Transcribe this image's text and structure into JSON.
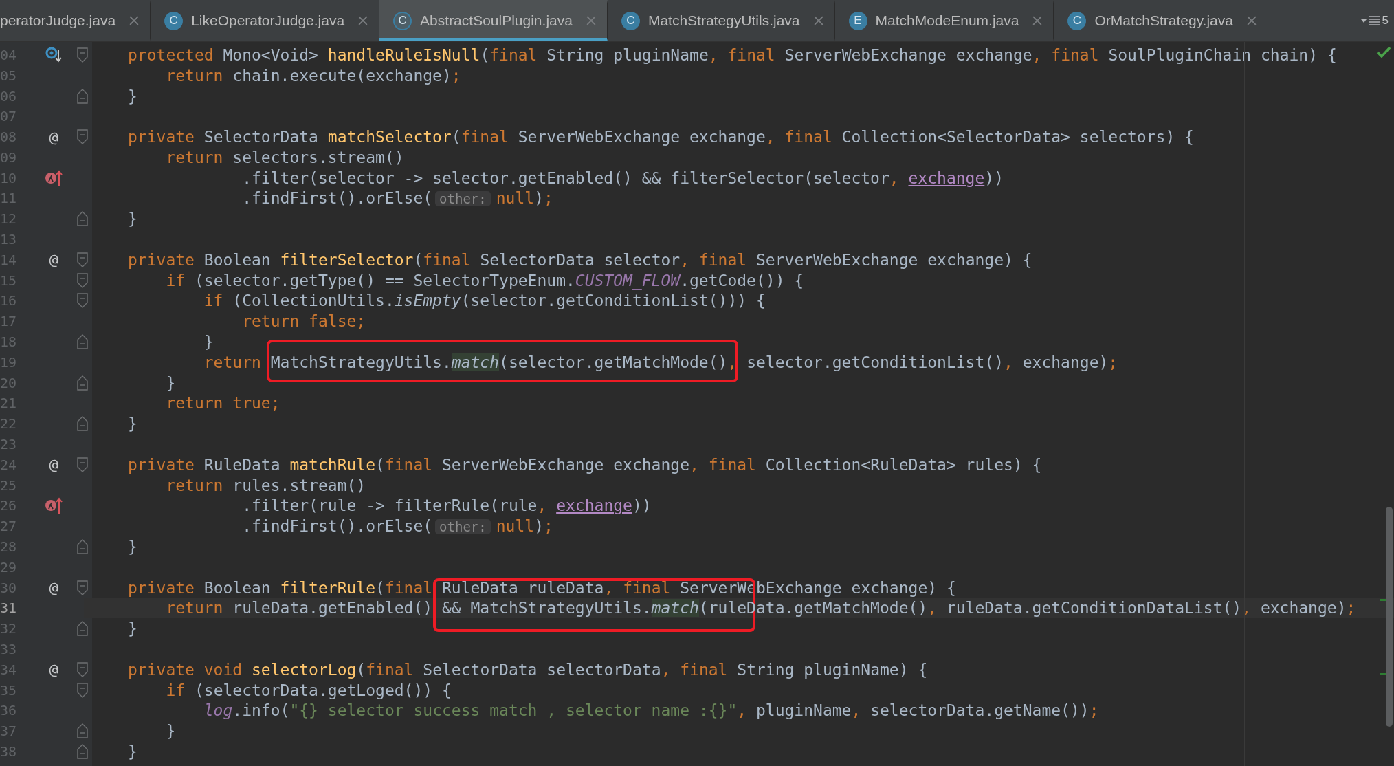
{
  "tabs": [
    {
      "label": "peratorJudge.java",
      "selected": false
    },
    {
      "label": "LikeOperatorJudge.java",
      "icon_letter": "C",
      "abstract": false,
      "selected": false
    },
    {
      "label": "AbstractSoulPlugin.java",
      "icon_letter": "C",
      "abstract": true,
      "selected": true
    },
    {
      "label": "MatchStrategyUtils.java",
      "icon_letter": "C",
      "abstract": false,
      "selected": false
    },
    {
      "label": "MatchModeEnum.java",
      "icon_letter": "E",
      "abstract": false,
      "selected": false
    },
    {
      "label": "OrMatchStrategy.java",
      "icon_letter": "C",
      "abstract": false,
      "selected": false
    }
  ],
  "tab_overflow": {
    "count": "5"
  },
  "lines": [
    {
      "number": "04",
      "current": false,
      "gutter": {
        "kind": "override"
      },
      "fold": {
        "kind": "start"
      },
      "tokens": [
        {
          "kind": "keyword",
          "t": "protected "
        },
        {
          "kind": "text",
          "t": "Mono<Void> "
        },
        {
          "kind": "declaration",
          "t": "handleRuleIsNull"
        },
        {
          "kind": "text",
          "t": "("
        },
        {
          "kind": "keyword",
          "t": "final "
        },
        {
          "kind": "text",
          "t": "String pluginName, "
        },
        {
          "kind": "keyword",
          "t": "final "
        },
        {
          "kind": "text",
          "t": "ServerWebExchange exchange, "
        },
        {
          "kind": "keyword",
          "t": "final "
        },
        {
          "kind": "text",
          "t": "SoulPluginChain chain) {"
        }
      ]
    },
    {
      "number": "05",
      "current": false,
      "tokens": [
        {
          "kind": "keyword",
          "t": "    return "
        },
        {
          "kind": "text",
          "t": "chain.execute(exchange);"
        }
      ]
    },
    {
      "number": "06",
      "current": false,
      "fold": {
        "kind": "end"
      },
      "tokens": [
        {
          "kind": "text",
          "t": "}"
        }
      ]
    },
    {
      "number": "07",
      "current": false
    },
    {
      "number": "08",
      "current": false,
      "gutter": {
        "kind": "text",
        "text": "@"
      },
      "fold": {
        "kind": "start"
      },
      "tokens": [
        {
          "kind": "keyword",
          "t": "private "
        },
        {
          "kind": "text",
          "t": "SelectorData "
        },
        {
          "kind": "declaration",
          "t": "matchSelector"
        },
        {
          "kind": "text",
          "t": "("
        },
        {
          "kind": "keyword",
          "t": "final "
        },
        {
          "kind": "text",
          "t": "ServerWebExchange exchange, "
        },
        {
          "kind": "keyword",
          "t": "final "
        },
        {
          "kind": "text",
          "t": "Collection<SelectorData> selectors) {"
        }
      ]
    },
    {
      "number": "09",
      "current": false,
      "tokens": [
        {
          "kind": "keyword",
          "t": "    return "
        },
        {
          "kind": "text",
          "t": "selectors.stream()"
        }
      ]
    },
    {
      "number": "10",
      "current": false,
      "gutter": {
        "kind": "lambda_recursion"
      },
      "tokens": [
        {
          "kind": "text",
          "t": "            .filter(selector -> selector.getEnabled() && filterSelector(selector, "
        },
        {
          "kind": "captured",
          "t": "exchange"
        },
        {
          "kind": "text",
          "t": "))"
        }
      ]
    },
    {
      "number": "11",
      "current": false,
      "tokens": [
        {
          "kind": "text",
          "t": "            .findFirst().orElse("
        },
        {
          "kind": "hint",
          "t": "other:"
        },
        {
          "kind": "keyword",
          "t": "null"
        },
        {
          "kind": "text",
          "t": ");"
        }
      ]
    },
    {
      "number": "12",
      "current": false,
      "fold": {
        "kind": "end"
      },
      "tokens": [
        {
          "kind": "text",
          "t": "}"
        }
      ]
    },
    {
      "number": "13",
      "current": false
    },
    {
      "number": "14",
      "current": false,
      "gutter": {
        "kind": "text",
        "text": "@"
      },
      "fold": {
        "kind": "start"
      },
      "tokens": [
        {
          "kind": "keyword",
          "t": "private "
        },
        {
          "kind": "text",
          "t": "Boolean "
        },
        {
          "kind": "declaration",
          "t": "filterSelector"
        },
        {
          "kind": "text",
          "t": "("
        },
        {
          "kind": "keyword",
          "t": "final "
        },
        {
          "kind": "text",
          "t": "SelectorData selector, "
        },
        {
          "kind": "keyword",
          "t": "final "
        },
        {
          "kind": "text",
          "t": "ServerWebExchange exchange) {"
        }
      ]
    },
    {
      "number": "15",
      "current": false,
      "fold": {
        "kind": "start"
      },
      "tokens": [
        {
          "kind": "keyword",
          "t": "    if "
        },
        {
          "kind": "text",
          "t": "(selector.getType() == SelectorTypeEnum."
        },
        {
          "kind": "constant",
          "t": "CUSTOM_FLOW"
        },
        {
          "kind": "text",
          "t": ".getCode()) {"
        }
      ]
    },
    {
      "number": "16",
      "current": false,
      "fold": {
        "kind": "start"
      },
      "tokens": [
        {
          "kind": "keyword",
          "t": "        if "
        },
        {
          "kind": "text",
          "t": "(CollectionUtils."
        },
        {
          "kind": "static_call",
          "t": "isEmpty"
        },
        {
          "kind": "text",
          "t": "(selector.getConditionList())) {"
        }
      ]
    },
    {
      "number": "17",
      "current": false,
      "tokens": [
        {
          "kind": "keyword",
          "t": "            return false;"
        }
      ]
    },
    {
      "number": "18",
      "current": false,
      "fold": {
        "kind": "end"
      },
      "tokens": [
        {
          "kind": "text",
          "t": "        }"
        }
      ]
    },
    {
      "number": "19",
      "current": false,
      "boxed": true,
      "tokens": [
        {
          "kind": "keyword",
          "t": "        return "
        },
        {
          "kind": "text",
          "t": "MatchStrategyUtils."
        },
        {
          "kind": "highlighted_call",
          "t": "match"
        },
        {
          "kind": "text",
          "t": "(selector.getMatchMode(), selector.getConditionList(), exchange);"
        }
      ]
    },
    {
      "number": "20",
      "current": false,
      "fold": {
        "kind": "end"
      },
      "tokens": [
        {
          "kind": "text",
          "t": "    }"
        }
      ]
    },
    {
      "number": "21",
      "current": false,
      "tokens": [
        {
          "kind": "keyword",
          "t": "    return true;"
        }
      ]
    },
    {
      "number": "22",
      "current": false,
      "fold": {
        "kind": "end"
      },
      "tokens": [
        {
          "kind": "text",
          "t": "}"
        }
      ]
    },
    {
      "number": "23",
      "current": false
    },
    {
      "number": "24",
      "current": false,
      "gutter": {
        "kind": "text",
        "text": "@"
      },
      "fold": {
        "kind": "start"
      },
      "tokens": [
        {
          "kind": "keyword",
          "t": "private "
        },
        {
          "kind": "text",
          "t": "RuleData "
        },
        {
          "kind": "declaration",
          "t": "matchRule"
        },
        {
          "kind": "text",
          "t": "("
        },
        {
          "kind": "keyword",
          "t": "final "
        },
        {
          "kind": "text",
          "t": "ServerWebExchange exchange, "
        },
        {
          "kind": "keyword",
          "t": "final "
        },
        {
          "kind": "text",
          "t": "Collection<RuleData> rules) {"
        }
      ]
    },
    {
      "number": "25",
      "current": false,
      "tokens": [
        {
          "kind": "keyword",
          "t": "    return "
        },
        {
          "kind": "text",
          "t": "rules.stream()"
        }
      ]
    },
    {
      "number": "26",
      "current": false,
      "gutter": {
        "kind": "lambda_recursion"
      },
      "tokens": [
        {
          "kind": "text",
          "t": "            .filter(rule -> filterRule(rule, "
        },
        {
          "kind": "captured",
          "t": "exchange"
        },
        {
          "kind": "text",
          "t": "))"
        }
      ]
    },
    {
      "number": "27",
      "current": false,
      "tokens": [
        {
          "kind": "text",
          "t": "            .findFirst().orElse("
        },
        {
          "kind": "hint",
          "t": "other:"
        },
        {
          "kind": "keyword",
          "t": "null"
        },
        {
          "kind": "text",
          "t": ");"
        }
      ]
    },
    {
      "number": "28",
      "current": false,
      "fold": {
        "kind": "end"
      },
      "tokens": [
        {
          "kind": "text",
          "t": "}"
        }
      ]
    },
    {
      "number": "29",
      "current": false
    },
    {
      "number": "30",
      "current": false,
      "boxed": true,
      "gutter": {
        "kind": "text",
        "text": "@"
      },
      "fold": {
        "kind": "start"
      },
      "tokens": [
        {
          "kind": "keyword",
          "t": "private "
        },
        {
          "kind": "text",
          "t": "Boolean "
        },
        {
          "kind": "declaration",
          "t": "filterRule"
        },
        {
          "kind": "text",
          "t": "("
        },
        {
          "kind": "keyword",
          "t": "final "
        },
        {
          "kind": "text",
          "t": "RuleData ruleData, "
        },
        {
          "kind": "keyword",
          "t": "final "
        },
        {
          "kind": "text",
          "t": "ServerWebExchange exchange) {"
        }
      ]
    },
    {
      "number": "31",
      "current": true,
      "tokens": [
        {
          "kind": "keyword",
          "t": "    return "
        },
        {
          "kind": "text",
          "t": "ruleData.getEnabled() && MatchStrategyUtils."
        },
        {
          "kind": "highlighted_call",
          "t": "match"
        },
        {
          "kind": "text",
          "t": "(ruleData.getMatchMode(), ruleData.getConditionDataList(), exchange);"
        }
      ]
    },
    {
      "number": "32",
      "current": false,
      "fold": {
        "kind": "end"
      },
      "tokens": [
        {
          "kind": "text",
          "t": "}"
        }
      ]
    },
    {
      "number": "33",
      "current": false
    },
    {
      "number": "34",
      "current": false,
      "gutter": {
        "kind": "text",
        "text": "@"
      },
      "fold": {
        "kind": "start"
      },
      "tokens": [
        {
          "kind": "keyword",
          "t": "private void "
        },
        {
          "kind": "declaration",
          "t": "selectorLog"
        },
        {
          "kind": "text",
          "t": "("
        },
        {
          "kind": "keyword",
          "t": "final "
        },
        {
          "kind": "text",
          "t": "SelectorData selectorData, "
        },
        {
          "kind": "keyword",
          "t": "final "
        },
        {
          "kind": "text",
          "t": "String pluginName) {"
        }
      ]
    },
    {
      "number": "35",
      "current": false,
      "fold": {
        "kind": "start"
      },
      "tokens": [
        {
          "kind": "keyword",
          "t": "    if "
        },
        {
          "kind": "text",
          "t": "(selectorData.getLoged()) {"
        }
      ]
    },
    {
      "number": "36",
      "current": false,
      "tokens": [
        {
          "kind": "logger",
          "t": "        log"
        },
        {
          "kind": "text",
          "t": ".info("
        },
        {
          "kind": "string",
          "t": "\"{} selector success match , selector name :{}\""
        },
        {
          "kind": "text",
          "t": ", pluginName, selectorData.getName());"
        }
      ]
    },
    {
      "number": "37",
      "current": false,
      "fold": {
        "kind": "end"
      },
      "tokens": [
        {
          "kind": "text",
          "t": "    }"
        }
      ]
    },
    {
      "number": "38",
      "current": false,
      "fold": {
        "kind": "end"
      },
      "tokens": [
        {
          "kind": "text",
          "t": "}"
        }
      ]
    }
  ]
}
